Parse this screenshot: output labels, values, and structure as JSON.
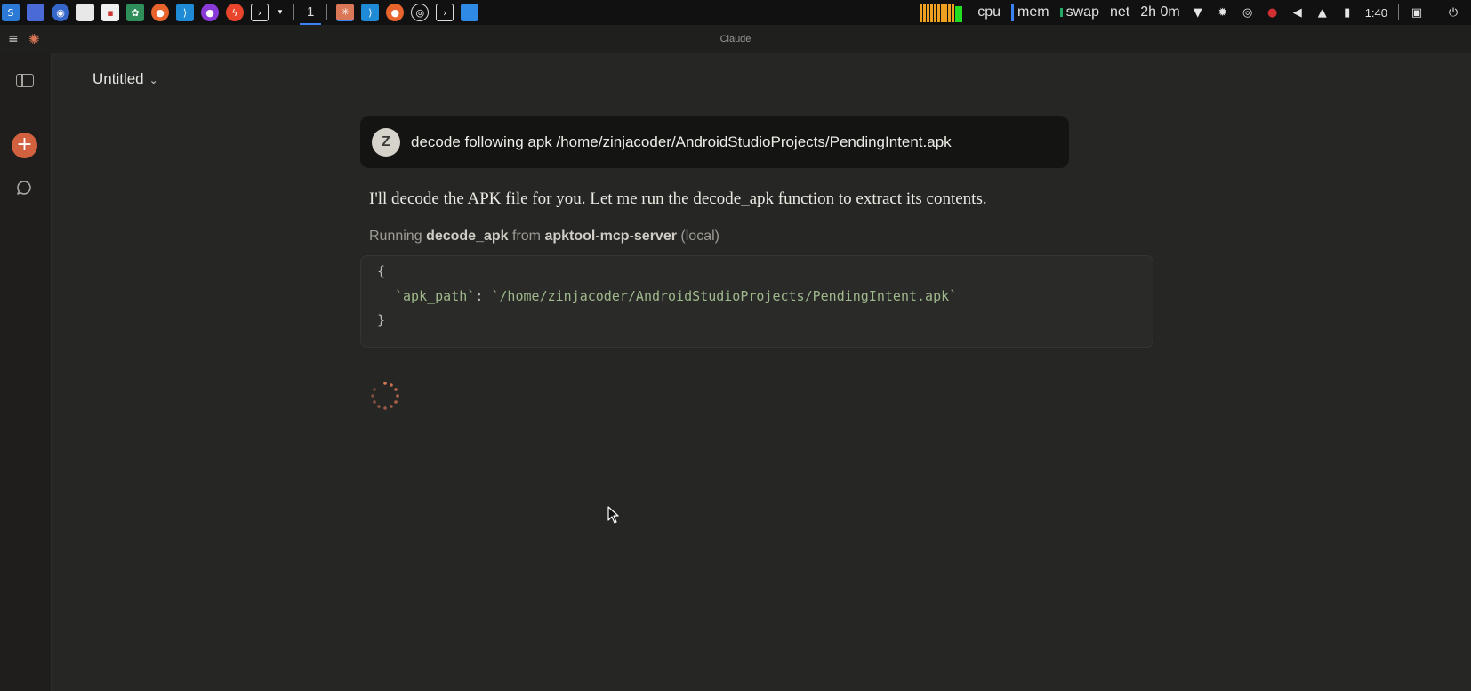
{
  "taskbar": {
    "workspace": "1",
    "stats": {
      "cpu": "cpu",
      "mem": "mem",
      "swap": "swap",
      "net": "net",
      "uptime": "2h 0m"
    },
    "clock": "1:40",
    "colors": {
      "accent": "#3b82f6",
      "bars": "#f0a020",
      "bars_active": "#22dd22"
    }
  },
  "window": {
    "title": "Claude"
  },
  "sidebar": {
    "icons": [
      "sidebar-toggle-icon",
      "new-chat-icon",
      "chats-icon"
    ],
    "accent": "#d2613f"
  },
  "chat": {
    "title": "Untitled",
    "user_message": {
      "avatar_initial": "Z",
      "text": "decode following apk /home/zinjacoder/AndroidStudioProjects/PendingIntent.apk"
    },
    "assistant_message": "I'll decode the APK file for you. Let me run the decode_apk function to extract its contents.",
    "tool_call": {
      "prefix": "Running",
      "tool": "decode_apk",
      "from": "from",
      "server": "apktool-mcp-server",
      "scope": "(local)"
    },
    "code": {
      "open": "{",
      "key": "`apk_path`",
      "colon": ":",
      "value": "`/home/zinjacoder/AndroidStudioProjects/PendingIntent.apk`",
      "close": "}"
    }
  }
}
